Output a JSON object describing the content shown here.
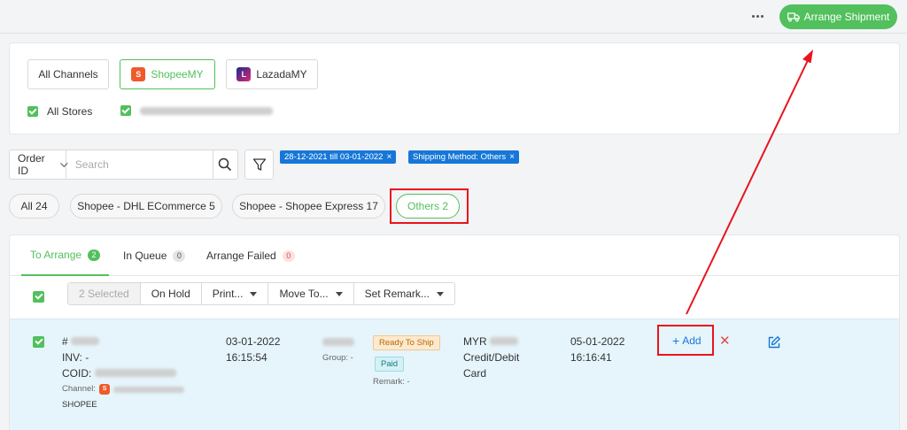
{
  "header": {
    "more_label": "more options",
    "arrange_label": "Arrange Shipment"
  },
  "channels": {
    "items": [
      {
        "label": "All Channels"
      },
      {
        "label": "ShopeeMY"
      },
      {
        "label": "LazadaMY"
      }
    ],
    "stores_label": "All Stores"
  },
  "search": {
    "field_label": "Order ID",
    "placeholder": "Search"
  },
  "filters": [
    {
      "label": "28-12-2021 till 03-01-2022"
    },
    {
      "label": "Shipping Method: Others"
    }
  ],
  "shipping_pills": [
    {
      "label": "All 24"
    },
    {
      "label": "Shopee - DHL ECommerce 5"
    },
    {
      "label": "Shopee - Shopee Express 17"
    },
    {
      "label": "Others 2"
    }
  ],
  "tabs": [
    {
      "label": "To Arrange",
      "count": "2"
    },
    {
      "label": "In Queue",
      "count": "0"
    },
    {
      "label": "Arrange Failed",
      "count": "0"
    }
  ],
  "toolbar": {
    "selected": "2 Selected",
    "on_hold": "On Hold",
    "print": "Print...",
    "move_to": "Move To...",
    "set_remark": "Set Remark..."
  },
  "order": {
    "hash": "#",
    "inv": "INV: -",
    "coid": "COID:",
    "channel": "Channel:",
    "platform": "SHOPEE",
    "order_date": "03-01-2022",
    "order_time": "16:15:54",
    "group": "Group: -",
    "status": "Ready To Ship",
    "payment_status": "Paid",
    "remark": "Remark: -",
    "currency": "MYR",
    "payment_line1": "Credit/Debit",
    "payment_line2": "Card",
    "ship_date": "05-01-2022",
    "ship_time": "16:16:41",
    "add_label": "Add"
  },
  "colors": {
    "accent": "#52c05c",
    "tag": "#1677d8",
    "highlight": "#e8141e",
    "row_bg": "#e5f5fb"
  }
}
